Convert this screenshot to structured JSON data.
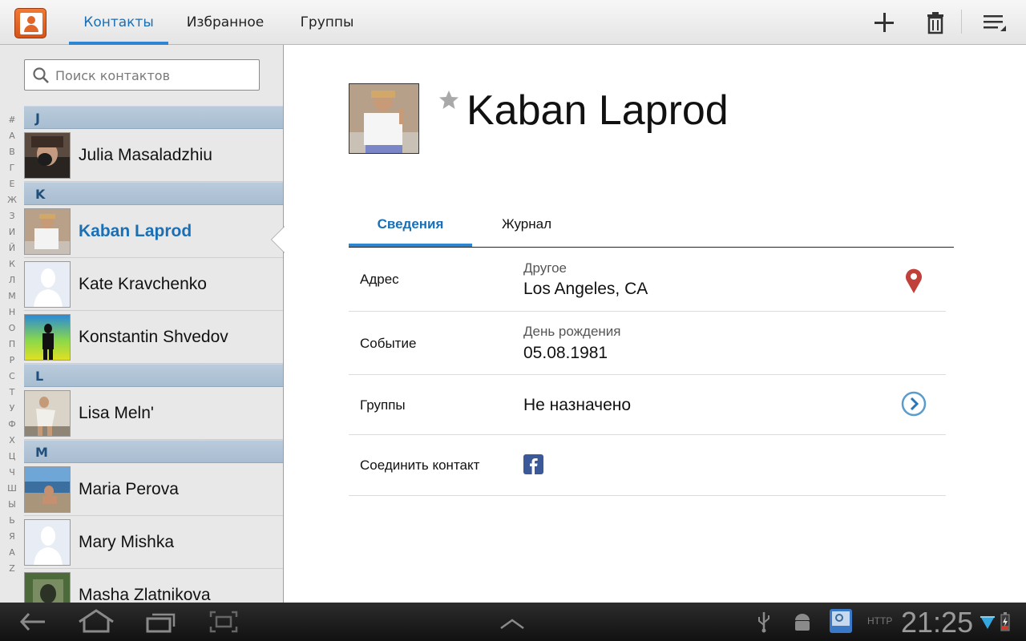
{
  "topbar": {
    "tabs": [
      {
        "label": "Контакты",
        "active": true
      },
      {
        "label": "Избранное",
        "active": false
      },
      {
        "label": "Группы",
        "active": false
      }
    ],
    "actions": [
      "add-icon",
      "delete-icon",
      "menu-icon"
    ]
  },
  "sidebar": {
    "search_placeholder": "Поиск контактов",
    "index": [
      "#",
      "А",
      "В",
      "Г",
      "Е",
      "Ж",
      "З",
      "И",
      "Й",
      "К",
      "Л",
      "М",
      "Н",
      "О",
      "П",
      "Р",
      "С",
      "Т",
      "У",
      "Ф",
      "Х",
      "Ц",
      "Ч",
      "Ш",
      "Ы",
      "Ь",
      "Я",
      "A",
      "Z"
    ],
    "sections": [
      {
        "letter": "J",
        "contacts": [
          {
            "name": "Julia Masaladzhiu",
            "avatar": "photo"
          }
        ]
      },
      {
        "letter": "K",
        "contacts": [
          {
            "name": "Kaban Laprod",
            "avatar": "photo",
            "selected": true
          },
          {
            "name": "Kate Kravchenko",
            "avatar": "placeholder"
          },
          {
            "name": "Konstantin Shvedov",
            "avatar": "photo"
          }
        ]
      },
      {
        "letter": "L",
        "contacts": [
          {
            "name": "Lisa Meln'",
            "avatar": "photo"
          }
        ]
      },
      {
        "letter": "M",
        "contacts": [
          {
            "name": "Maria Perova",
            "avatar": "photo"
          },
          {
            "name": "Mary Mishka",
            "avatar": "placeholder"
          },
          {
            "name": "Masha Zlatnikova",
            "avatar": "photo"
          }
        ]
      }
    ]
  },
  "detail": {
    "name": "Kaban Laprod",
    "tabs": [
      {
        "label": "Сведения",
        "active": true
      },
      {
        "label": "Журнал",
        "active": false
      }
    ],
    "fields": {
      "address": {
        "label": "Адрес",
        "sub": "Другое",
        "value": "Los Angeles, CA"
      },
      "event": {
        "label": "Событие",
        "sub": "День рождения",
        "value": "05.08.1981"
      },
      "groups": {
        "label": "Группы",
        "value": "Не назначено"
      },
      "link": {
        "label": "Соединить контакт",
        "service": "facebook-icon"
      }
    }
  },
  "statusbar": {
    "time": "21:25",
    "http_label": "HTTP",
    "nav": [
      "back-icon",
      "home-icon",
      "recent-apps-icon",
      "screenshot-icon",
      "expand-up-icon"
    ],
    "notifications": [
      "usb-icon",
      "android-debug-icon",
      "app-notification-icon",
      "wifi-icon",
      "battery-icon"
    ]
  },
  "colors": {
    "accent": "#1a6fb5",
    "section_bg": "#b1c4d7",
    "sidebar_bg": "#e8e8e8",
    "map_pin": "#c0403a"
  }
}
